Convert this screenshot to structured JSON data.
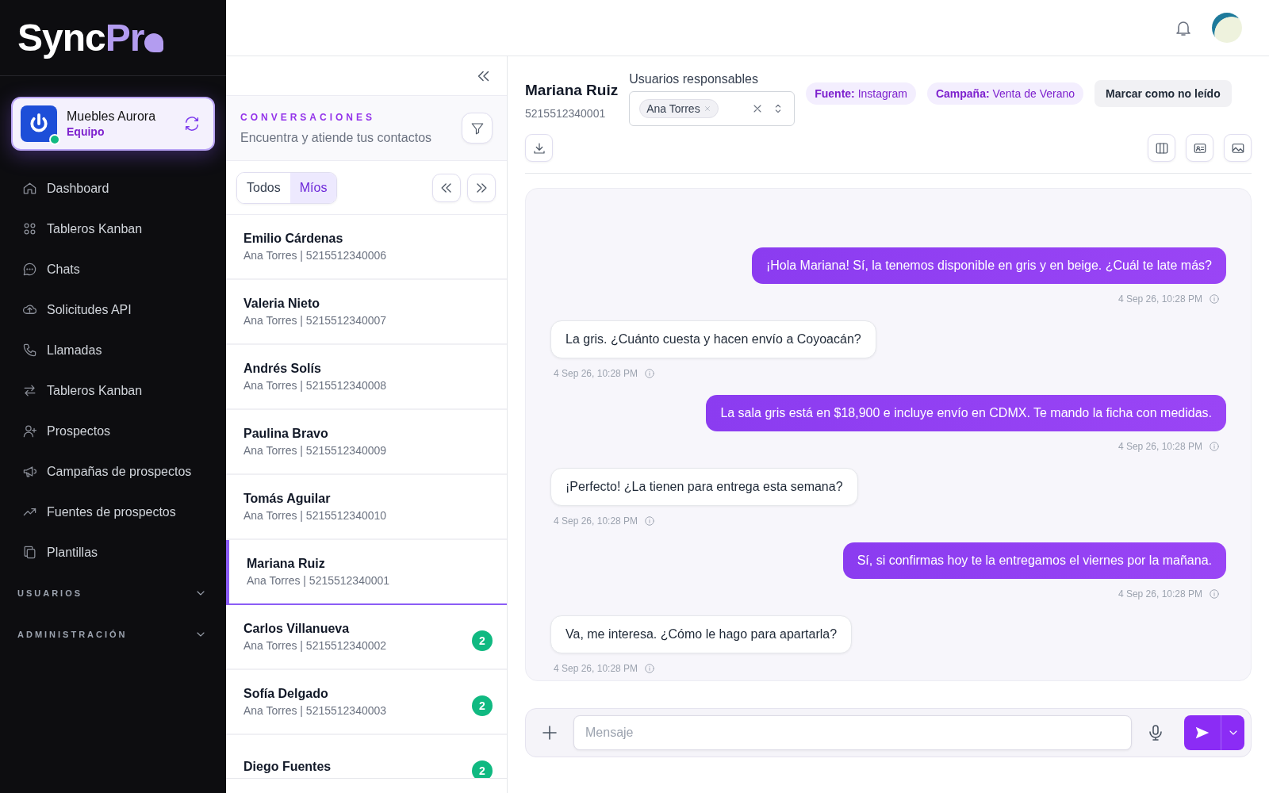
{
  "brand": {
    "logo_main": "Sync",
    "logo_accent": "Pr"
  },
  "workspace": {
    "name": "Muebles Aurora",
    "role": "Equipo",
    "online": true
  },
  "nav": [
    {
      "label": "Dashboard"
    },
    {
      "label": "Tableros Kanban"
    },
    {
      "label": "Chats"
    },
    {
      "label": "Solicitudes API"
    },
    {
      "label": "Llamadas"
    },
    {
      "label": "Tableros Kanban"
    },
    {
      "label": "Prospectos"
    },
    {
      "label": "Campañas de prospectos"
    },
    {
      "label": "Fuentes de prospectos"
    },
    {
      "label": "Plantillas"
    }
  ],
  "nav_sections": [
    {
      "label": "USUARIOS",
      "expanded": false
    },
    {
      "label": "ADMINISTRACIÓN",
      "expanded": false
    }
  ],
  "conversations": {
    "heading": "CONVERSACIONES",
    "subheading": "Encuentra y atiende tus contactos",
    "tabs": [
      {
        "label": "Todos",
        "selected": false
      },
      {
        "label": "Míos",
        "selected": true
      }
    ],
    "items": [
      {
        "name": "Emilio Cárdenas",
        "detail": "Ana Torres | 5215512340006",
        "selected": false
      },
      {
        "name": "Valeria Nieto",
        "detail": "Ana Torres | 5215512340007",
        "selected": false
      },
      {
        "name": "Andrés Solís",
        "detail": "Ana Torres | 5215512340008",
        "selected": false
      },
      {
        "name": "Paulina Bravo",
        "detail": "Ana Torres | 5215512340009",
        "selected": false
      },
      {
        "name": "Tomás Aguilar",
        "detail": "Ana Torres | 5215512340010",
        "selected": false
      },
      {
        "name": "Mariana Ruiz",
        "detail": "Ana Torres | 5215512340001",
        "selected": true
      },
      {
        "name": "Carlos Villanueva",
        "detail": "Ana Torres | 5215512340002",
        "selected": false,
        "unread": "2"
      },
      {
        "name": "Sofía Delgado",
        "detail": "Ana Torres | 5215512340003",
        "selected": false,
        "unread": "2"
      },
      {
        "name": "Diego Fuentes",
        "selected": false,
        "unread": "2"
      }
    ]
  },
  "chat": {
    "contact_name": "Mariana Ruiz",
    "contact_phone": "5215512340001",
    "assignees_label": "Usuarios responsables",
    "assignees": [
      "Ana Torres"
    ],
    "tags": [
      {
        "label": "Fuente:",
        "value": "Instagram"
      },
      {
        "label": "Campaña:",
        "value": "Venta de Verano"
      }
    ],
    "mark_unread": "Marcar como no leído",
    "messages": [
      {
        "kind": "outgoing",
        "text": "¡Hola Mariana! Sí, la tenemos disponible en gris y en beige. ¿Cuál te late más?",
        "time": "4 Sep 26, 10:28 PM"
      },
      {
        "kind": "incoming",
        "text": "La gris. ¿Cuánto cuesta y hacen envío a Coyoacán?",
        "time": "4 Sep 26, 10:28 PM"
      },
      {
        "kind": "outgoing",
        "text": "La sala gris está en $18,900 e incluye envío en CDMX. Te mando la ficha con medidas.",
        "time": "4 Sep 26, 10:28 PM"
      },
      {
        "kind": "incoming",
        "text": "¡Perfecto! ¿La tienen para entrega esta semana?",
        "time": "4 Sep 26, 10:28 PM"
      },
      {
        "kind": "outgoing",
        "text": "Sí, si confirmas hoy te la entregamos el viernes por la mañana.",
        "time": "4 Sep 26, 10:28 PM"
      },
      {
        "kind": "incoming",
        "text": "Va, me interesa. ¿Cómo le hago para apartarla?",
        "time": "4 Sep 26, 10:28 PM"
      }
    ],
    "composer": {
      "placeholder": "Mensaje"
    }
  }
}
